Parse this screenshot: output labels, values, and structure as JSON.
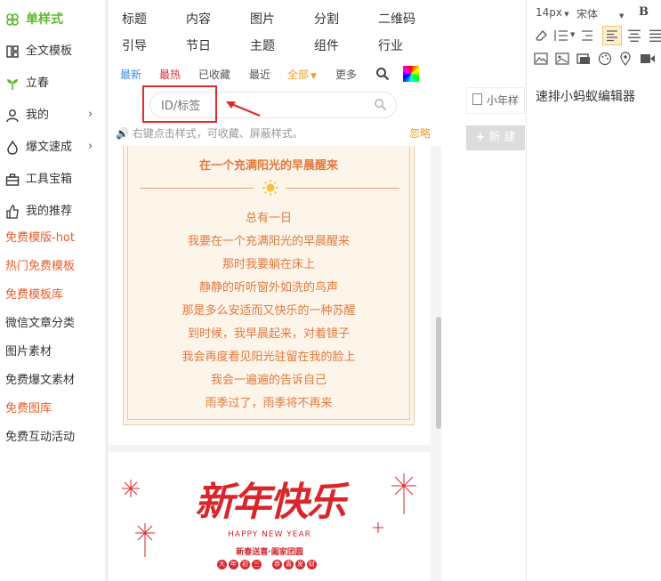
{
  "sidebar": {
    "items": [
      {
        "label": "单样式",
        "icon": "clover-icon",
        "style": "green"
      },
      {
        "label": "全文模板",
        "icon": "template-icon",
        "style": "normal"
      },
      {
        "label": "立春",
        "icon": "sprout-icon",
        "style": "normal"
      },
      {
        "label": "我的",
        "icon": "user-icon",
        "style": "normal",
        "arrow": "›"
      },
      {
        "label": "爆文速成",
        "icon": "fire-icon",
        "style": "normal",
        "arrow": "›"
      },
      {
        "label": "工具宝箱",
        "icon": "toolbox-icon",
        "style": "normal"
      },
      {
        "label": "我的推荐",
        "icon": "thumb-icon",
        "style": "normal"
      },
      {
        "label": "免费模版-hot",
        "style": "hot"
      },
      {
        "label": "热门免费模板",
        "style": "hot"
      },
      {
        "label": "免费模板库",
        "style": "hot"
      },
      {
        "label": "微信文章分类",
        "style": "normal"
      },
      {
        "label": "图片素材",
        "style": "normal"
      },
      {
        "label": "免费爆文素材",
        "style": "normal"
      },
      {
        "label": "免费图库",
        "style": "hot"
      },
      {
        "label": "免费互动活动",
        "style": "normal"
      }
    ]
  },
  "categories": [
    "标题",
    "内容",
    "图片",
    "分割",
    "二维码",
    "引导",
    "节日",
    "主题",
    "组件",
    "行业"
  ],
  "filters": {
    "newest": "最新",
    "hottest": "最热",
    "favorited": "已收藏",
    "recent": "最近",
    "all": "全部",
    "more": "更多"
  },
  "search": {
    "placeholder": "ID/标签"
  },
  "tip": {
    "text": "右键点击样式，可收藏、屏蔽样式。",
    "ignore": "忽略"
  },
  "poem": {
    "title": "在一个充满阳光的早晨醒来",
    "lines": [
      "总有一日",
      "我要在一个充满阳光的早晨醒来",
      "那时我要躺在床上",
      "静静的听听窗外如洗的鸟声",
      "那是多么安适而又快乐的一种苏醒",
      "到时候，我早晨起来，对着镜子",
      "我会再度看见阳光驻留在我的脸上",
      "我会一遍遍的告诉自己",
      "雨季过了，雨季将不再来"
    ]
  },
  "card2": {
    "title_art": "新年快乐",
    "subtitle": "HAPPY NEW YEAR",
    "slogan": "新春送喜·阖家团圆",
    "badges_left": [
      "大",
      "年",
      "初",
      "三"
    ],
    "badges_right": [
      "恭",
      "喜",
      "发",
      "财"
    ]
  },
  "right": {
    "tab_label": "小年样",
    "new_button": "新 建",
    "new_button_icon": "plus-icon"
  },
  "editor": {
    "font_size": "14px",
    "font_family": "宋体",
    "bold": "B",
    "content": "速排小蚂蚁编辑器"
  },
  "colors": {
    "accent_green": "#59b82b",
    "hot_orange": "#e85d2a",
    "poem_orange": "#e27a3e",
    "red": "#d9262c"
  }
}
